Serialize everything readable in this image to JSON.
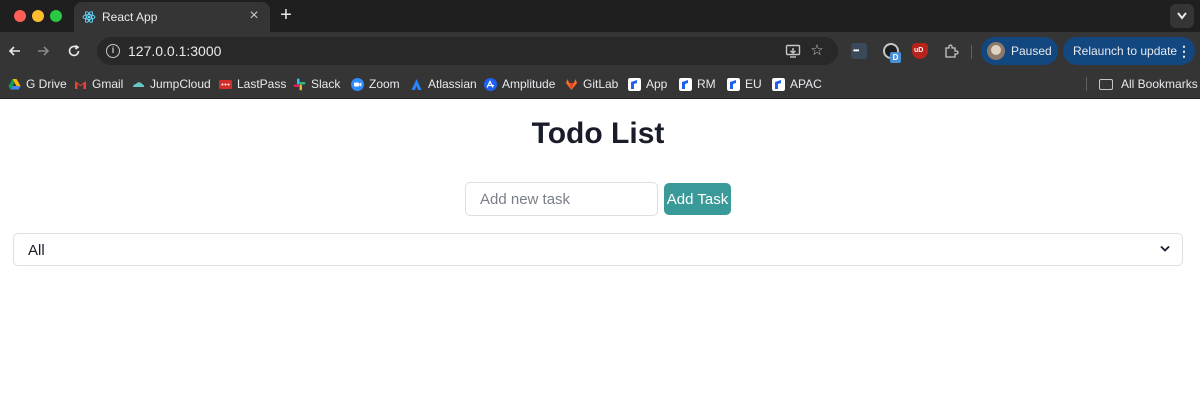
{
  "browser": {
    "tab": {
      "title": "React App"
    },
    "address_bar": {
      "url": "127.0.0.1:3000"
    },
    "profile": {
      "label": "Paused"
    },
    "relaunch": {
      "label": "Relaunch to update"
    },
    "extension_badge": "D",
    "extension_ud": "uD",
    "bookmarks": [
      {
        "label": "G Drive",
        "icon": "google-drive-icon",
        "color": "#4285f4"
      },
      {
        "label": "Gmail",
        "icon": "gmail-icon",
        "color": "#ea4335"
      },
      {
        "label": "JumpCloud",
        "icon": "jumpcloud-icon",
        "color": "#64c8c8"
      },
      {
        "label": "LastPass",
        "icon": "lastpass-icon",
        "color": "#d32d27"
      },
      {
        "label": "Slack",
        "icon": "slack-icon",
        "color": "#36c5f0"
      },
      {
        "label": "Zoom",
        "icon": "zoom-icon",
        "color": "#2d8cff"
      },
      {
        "label": "Atlassian",
        "icon": "atlassian-icon",
        "color": "#2684ff"
      },
      {
        "label": "Amplitude",
        "icon": "amplitude-icon",
        "color": "#1e61f0"
      },
      {
        "label": "GitLab",
        "icon": "gitlab-icon",
        "color": "#fc6d26"
      },
      {
        "label": "App",
        "icon": "bookmark-site-icon",
        "color": "#ffffff"
      },
      {
        "label": "RM",
        "icon": "bookmark-site-icon",
        "color": "#ffffff"
      },
      {
        "label": "EU",
        "icon": "bookmark-site-icon",
        "color": "#ffffff"
      },
      {
        "label": "APAC",
        "icon": "bookmark-site-icon",
        "color": "#ffffff"
      }
    ],
    "all_bookmarks": {
      "label": "All Bookmarks"
    }
  },
  "page": {
    "title": "Todo List",
    "task_input": {
      "value": "",
      "placeholder": "Add new task"
    },
    "add_button": {
      "label": "Add Task"
    },
    "filter": {
      "selected": "All"
    }
  }
}
